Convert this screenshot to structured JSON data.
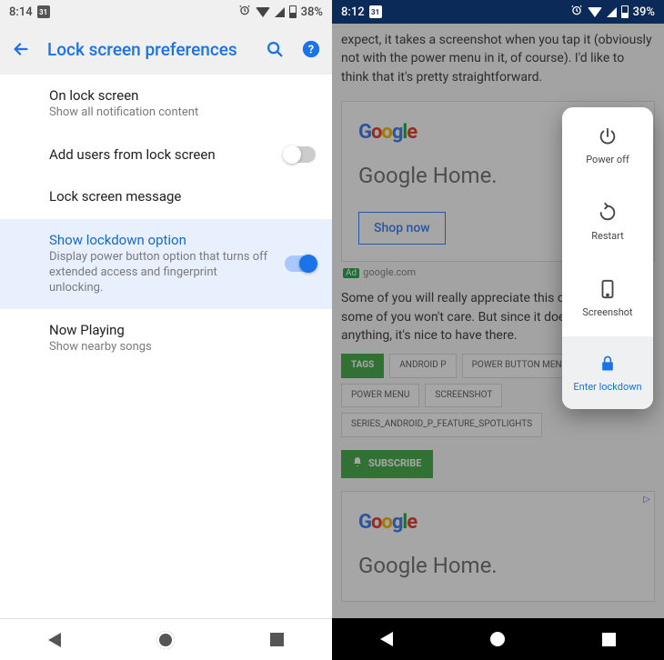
{
  "left": {
    "status": {
      "time": "8:14",
      "cal": "31",
      "battery": "38%"
    },
    "header": {
      "title": "Lock screen preferences"
    },
    "prefs": {
      "onlock": {
        "title": "On lock screen",
        "sub": "Show all notification content"
      },
      "addusers": {
        "title": "Add users from lock screen"
      },
      "lockmsg": {
        "title": "Lock screen message",
        "sub": " "
      },
      "lockdown": {
        "title": "Show lockdown option",
        "sub": "Display power button option that turns off extended access and fingerprint unlocking."
      },
      "nowplaying": {
        "title": "Now Playing",
        "sub": "Show nearby songs"
      }
    }
  },
  "right": {
    "status": {
      "time": "8:12",
      "cal": "31",
      "battery": "39%"
    },
    "article": {
      "intro": "expect, it takes a screenshot when you tap it (obviously not with the power menu in it, of course). I'd like to think that it's pretty straightforward.",
      "ad": {
        "title": "Google Home.",
        "button": "Shop now",
        "footer_label": "Ad",
        "footer_domain": "google.com"
      },
      "para2": "Some of you will really appreciate this change, and some of you won't care. But since it doesn't hurt anything, it's nice to have there.",
      "tags": {
        "label": "TAGS",
        "items": [
          "ANDROID P",
          "POWER BUTTON MENU",
          "POWER MENU",
          "SCREENSHOT",
          "SERIES_ANDROID_P_FEATURE_SPOTLIGHTS"
        ]
      },
      "subscribe": "SUBSCRIBE",
      "ad2": {
        "title": "Google Home."
      }
    },
    "power_menu": {
      "poweroff": "Power off",
      "restart": "Restart",
      "screenshot": "Screenshot",
      "lockdown": "Enter lockdown"
    }
  }
}
